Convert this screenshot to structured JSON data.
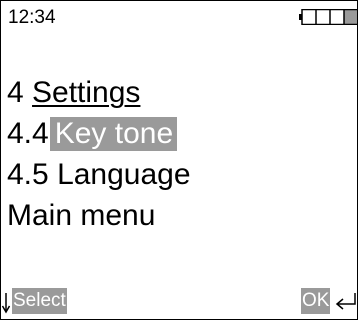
{
  "status": {
    "time": "12:34",
    "battery_icon": "battery-icon",
    "battery_level": 0.25
  },
  "menu": {
    "title_number": "4",
    "title_label": "Settings",
    "items": [
      {
        "number": "4.4",
        "label": "Key tone",
        "selected": true
      },
      {
        "number": "4.5",
        "label": "Language",
        "selected": false
      }
    ],
    "main_menu_label": "Main menu"
  },
  "softkeys": {
    "left_label": "Select",
    "left_icon": "down-arrow-icon",
    "right_label": "OK",
    "right_icon": "enter-icon"
  },
  "colors": {
    "highlight": "#9a9a9a",
    "text": "#000000",
    "background": "#ffffff"
  }
}
